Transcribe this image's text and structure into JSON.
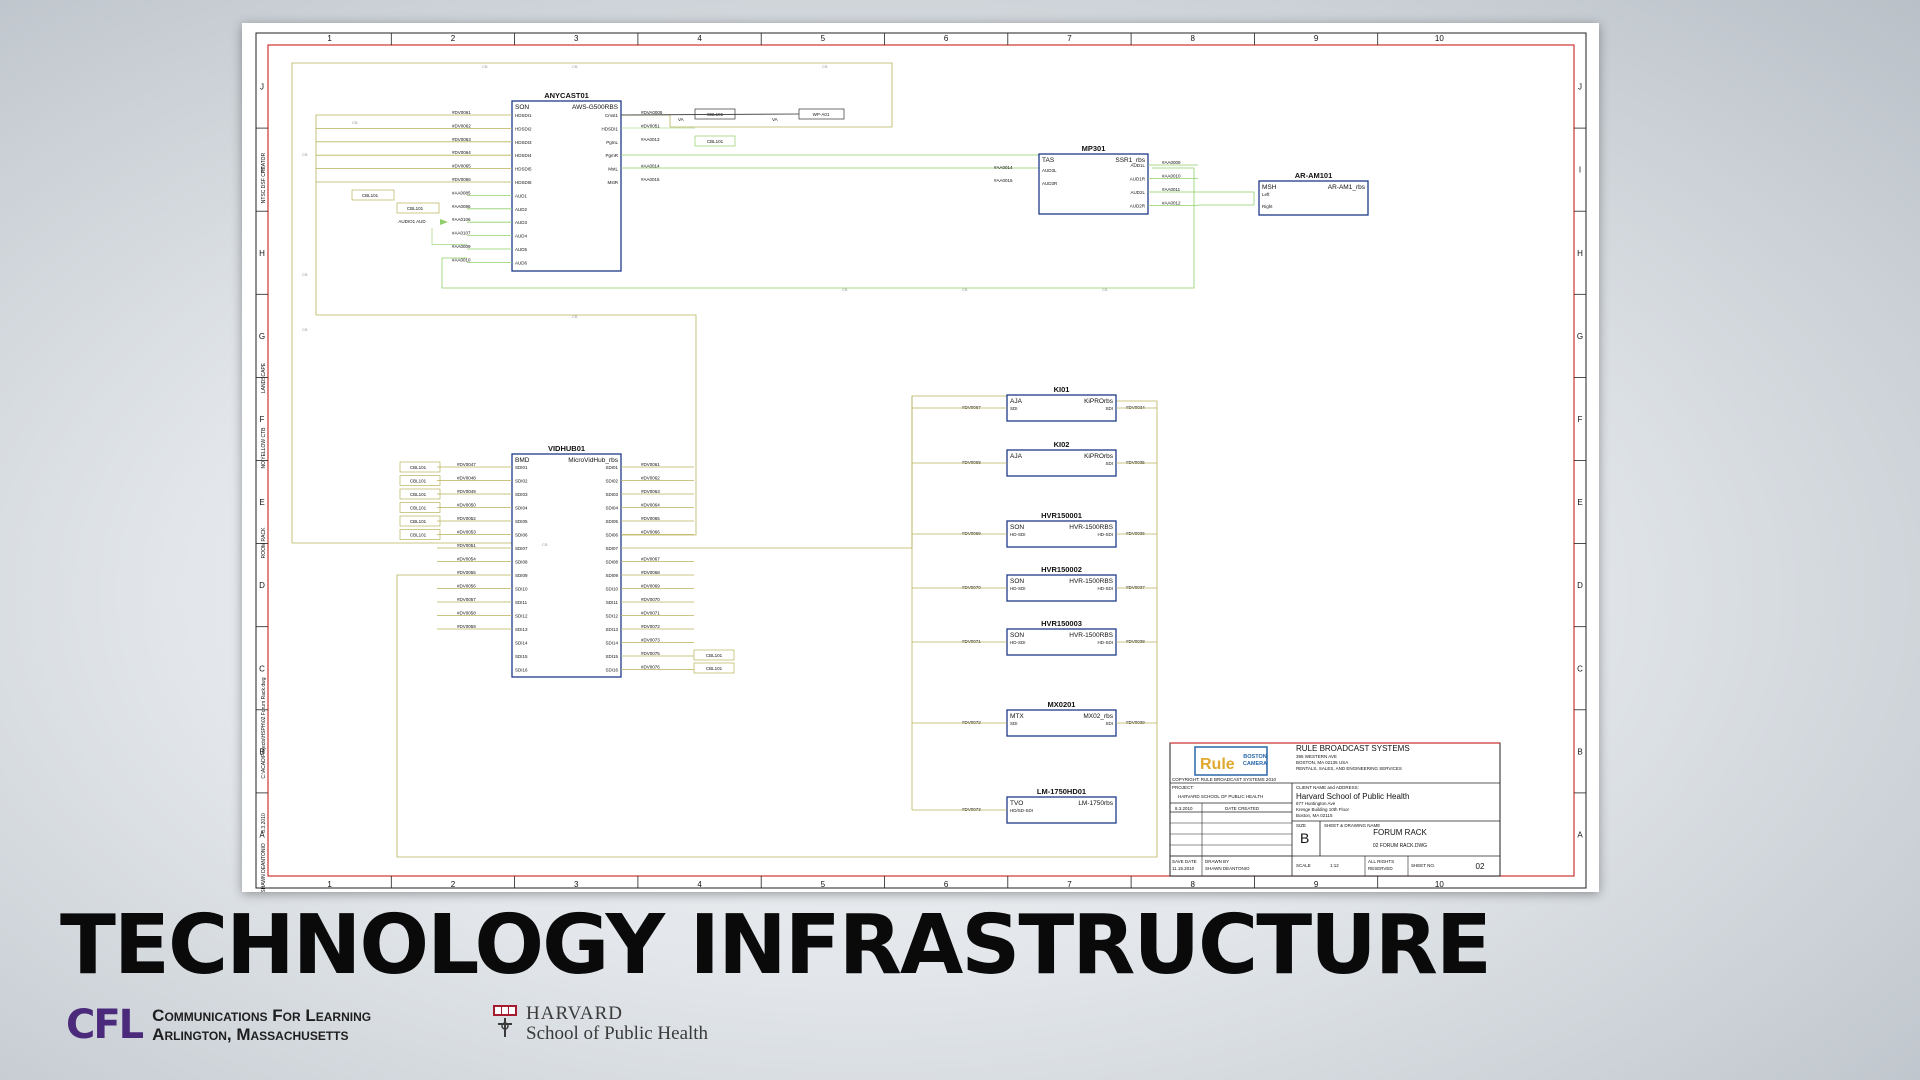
{
  "slide": {
    "title": "TECHNOLOGY INFRASTRUCTURE",
    "logos": {
      "cfl": {
        "mark": "CFL",
        "line1": "Communications For Learning",
        "line2": "Arlington, Massachusetts"
      },
      "harvard": {
        "line1": "HARVARD",
        "line2": "School of Public Health"
      }
    }
  },
  "drawing": {
    "columns": [
      "1",
      "2",
      "3",
      "4",
      "5",
      "6",
      "7",
      "8",
      "9",
      "10"
    ],
    "rows": [
      "J",
      "I",
      "H",
      "G",
      "F",
      "E",
      "D",
      "C",
      "B",
      "A"
    ],
    "side_notes": [
      "NTSC DSF CREATOR",
      "LANDSCAPE",
      "NO YELLOW CTB",
      "ROOM RACK",
      "C:\\ACAD\\Projects\\HSPH\\02 Forum Rack.dwg",
      "8.3.2010",
      "SHAWN DEANTONIO"
    ],
    "devices": {
      "anycast": {
        "name": "ANYCAST01",
        "mfr": "SON",
        "model": "AWS-G500RBS",
        "inputs": [
          "HDSDI1",
          "HDSDI2",
          "HDSDI3",
          "HDSDI4",
          "HDSDI5",
          "HDSDI6",
          "AUD1",
          "AUD2",
          "AUD3",
          "AUD4",
          "AUD5",
          "AUD6"
        ],
        "outputs": [
          "Cmst1",
          "HDSDI1",
          "PgmL",
          "PgmR",
          "MstL",
          "MstR"
        ],
        "in_cables": [
          "#DV0061",
          "#DV0062",
          "#DV0063",
          "#DV0064",
          "#DV0065",
          "#DV0066",
          "#AA0085",
          "#AA0086",
          "#AA0106",
          "#AA0107",
          "#AA0009",
          "#AA0010"
        ],
        "out_cables": [
          "#DVA0005",
          "#DV0051",
          "#AA0013",
          "",
          "#AA0014",
          "#AA0015"
        ]
      },
      "mp301": {
        "name": "MP301",
        "mfr": "TAS",
        "model": "SSR1_rbs",
        "inputs": [
          "AUD3L",
          "AUD3R"
        ],
        "outputs": [
          "AUD1L",
          "AUD1R",
          "AUD2L",
          "AUD2R"
        ],
        "in_cables": [
          "#AA0014",
          "#AA0015"
        ],
        "out_cables": [
          "#AA0009",
          "#AA0010",
          "#AA0011",
          "#AA0012"
        ]
      },
      "aram": {
        "name": "AR-AM101",
        "mfr": "MSH",
        "model": "AR-AM1_rbs",
        "inputs": [
          "Left",
          "Right"
        ]
      },
      "vidhub": {
        "name": "VIDHUB01",
        "mfr": "BMD",
        "model": "MicroVidHub_rbs",
        "inputs": [
          "SDI01",
          "SDI02",
          "SDI03",
          "SDI04",
          "SDI05",
          "SDI06",
          "SDI07",
          "SDI08",
          "SDI09",
          "SDI10",
          "SDI11",
          "SDI12",
          "SDI13",
          "SDI14",
          "SDI15",
          "SDI16"
        ],
        "outputs": [
          "SDI01",
          "SDI02",
          "SDI03",
          "SDI04",
          "SDI05",
          "SDI06",
          "SDI07",
          "SDI08",
          "SDI09",
          "SDI10",
          "SDI11",
          "SDI12",
          "SDI13",
          "SDI14",
          "SDI15",
          "SDI16"
        ],
        "in_cables": [
          "#DV0047",
          "#DV0048",
          "#DV0049",
          "#DV0050",
          "#DV0052",
          "#DV0053",
          "#DV0051",
          "#DV0054",
          "#DV0055",
          "#DV0056",
          "#DV0057",
          "#DV0058",
          "#DV0059",
          "",
          "",
          ""
        ],
        "out_cables": [
          "#DV0061",
          "#DV0062",
          "#DV0063",
          "#DV0064",
          "#DV0065",
          "#DV0066",
          "",
          "#DV0067",
          "#DV0068",
          "#DV0069",
          "#DV0070",
          "#DV0071",
          "#DV0072",
          "#DV0073",
          "#DV0075",
          "#DV0076"
        ]
      },
      "right": [
        {
          "name": "KI01",
          "mfr": "AJA",
          "model": "KiPROrbs",
          "pin_in": "SDI",
          "pin_out": "SDI",
          "cable_in": "#DV0067",
          "cable_out": "#DV0034"
        },
        {
          "name": "KI02",
          "mfr": "AJA",
          "model": "KiPROrbs",
          "pin_in": "",
          "pin_out": "SDI",
          "cable_in": "#DV0068",
          "cable_out": "#DV0035"
        },
        {
          "name": "HVR150001",
          "mfr": "SON",
          "model": "HVR-1500RBS",
          "pin_in": "HD-SDI",
          "pin_out": "HD-SDI",
          "cable_in": "#DV0069",
          "cable_out": "#DV0036"
        },
        {
          "name": "HVR150002",
          "mfr": "SON",
          "model": "HVR-1500RBS",
          "pin_in": "HD-SDI",
          "pin_out": "HD-SDI",
          "cable_in": "#DV0070",
          "cable_out": "#DV0037"
        },
        {
          "name": "HVR150003",
          "mfr": "SON",
          "model": "HVR-1500RBS",
          "pin_in": "HD-SDI",
          "pin_out": "HD-SDI",
          "cable_in": "#DV0071",
          "cable_out": "#DV0038"
        },
        {
          "name": "MX0201",
          "mfr": "MTX",
          "model": "MX02_rbs",
          "pin_in": "SDI",
          "pin_out": "SDI",
          "cable_in": "#DV0072",
          "cable_out": "#DV0039"
        },
        {
          "name": "LM-1750HD01",
          "mfr": "TVO",
          "model": "LM-1750rbs",
          "pin_in": "HD/SD-SDI",
          "pin_out": "",
          "cable_in": "#DV0073",
          "cable_out": ""
        }
      ],
      "cbl_label": "CBL101",
      "wp": "WP-A01",
      "va": "VA",
      "aud_label": "AUDIO1 AUD",
      "wire_tag": "CB"
    },
    "title_block": {
      "company": "RULE BROADCAST SYSTEMS",
      "address1": "395 WESTERN AVE",
      "address2": "BOSTON, MA 02135 USA",
      "services": "RENTALS, SALES, AND ENGINEERING SERVICES",
      "logo_word": "Rule",
      "logo_sub1": "BOSTON",
      "logo_sub2": "CAMERA",
      "copyright": "COPYRIGHT: RULE BROADCAST SYSTEMS 2010",
      "project_label": "PROJECT:",
      "project": "HARVARD SCHOOL OF PUBLIC HEALTH",
      "client_label": "CLIENT NAME and ADDRESS:",
      "client": "Harvard School of Public Health",
      "client_addr1": "677 Huntington Ave",
      "client_addr2": "Kresge Building 10th Floor",
      "client_addr3": "Boston, MA 02115",
      "date": "8.3.2010",
      "date_label": "DATE CREATED",
      "size_label": "SIZE",
      "size": "B",
      "sheet_name_label": "SHEET & DRAWING NAME",
      "sheet_name": "FORUM RACK",
      "file_name": "02 FORUM RACK.DWG",
      "save_date_label": "SAVE DATE",
      "save_date": "11.19.2010",
      "drawn_by_label": "DRAWN BY",
      "drawn_by": "SHAWN DEANTONIO",
      "scale_label": "SCALE",
      "scale": "1:12",
      "rights": "ALL RIGHTS RESERVED",
      "sheet_no_label": "SHEET NO.",
      "sheet_no": "02"
    }
  },
  "colors": {
    "title": "#0a0a0a",
    "cfl_purple": "#4b2a7b",
    "harvard_crimson": "#a51c30",
    "border_red": "#cc3333",
    "box_blue": "#1d3a8a",
    "wire_olive": "#b8b25a",
    "wire_green": "#8fcf6a"
  }
}
